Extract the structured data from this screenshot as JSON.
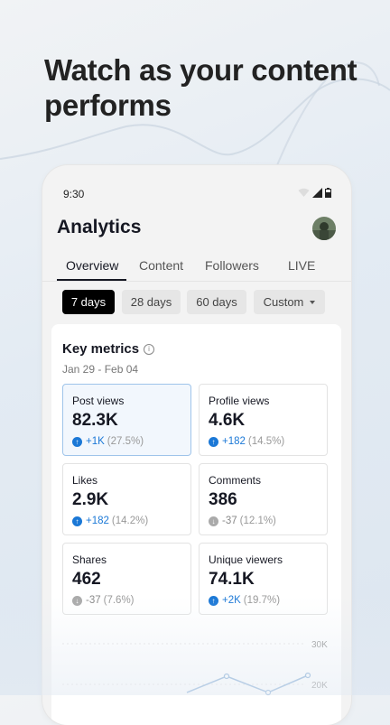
{
  "headline": "Watch as your content performs",
  "status_bar": {
    "time": "9:30"
  },
  "header": {
    "title": "Analytics"
  },
  "tabs": [
    "Overview",
    "Content",
    "Followers",
    "LIVE"
  ],
  "date_filters": [
    "7 days",
    "28 days",
    "60 days",
    "Custom"
  ],
  "key_metrics": {
    "title": "Key metrics",
    "date_range": "Jan 29 - Feb 04",
    "items": [
      {
        "label": "Post views",
        "value": "82.3K",
        "delta": "+1K",
        "percent": "(27.5%)",
        "direction": "up",
        "selected": true
      },
      {
        "label": "Profile views",
        "value": "4.6K",
        "delta": "+182",
        "percent": "(14.5%)",
        "direction": "up"
      },
      {
        "label": "Likes",
        "value": "2.9K",
        "delta": "+182",
        "percent": "(14.2%)",
        "direction": "up"
      },
      {
        "label": "Comments",
        "value": "386",
        "delta": "-37",
        "percent": "(12.1%)",
        "direction": "down"
      },
      {
        "label": "Shares",
        "value": "462",
        "delta": "-37",
        "percent": "(7.6%)",
        "direction": "down"
      },
      {
        "label": "Unique viewers",
        "value": "74.1K",
        "delta": "+2K",
        "percent": "(19.7%)",
        "direction": "up"
      }
    ]
  },
  "chart": {
    "tick_labels": [
      "30K",
      "20K"
    ]
  },
  "colors": {
    "accent": "#1b78d6",
    "text": "#161823",
    "negative": "#aaaaaa"
  }
}
